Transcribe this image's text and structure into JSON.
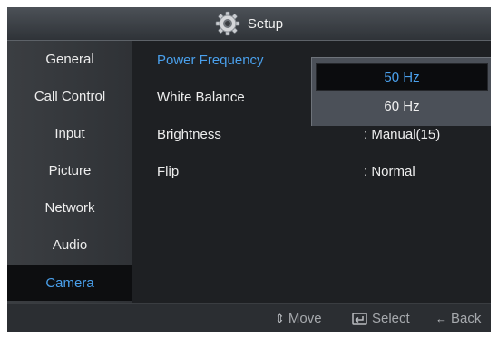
{
  "title": "Setup",
  "title_icon": "gear-icon",
  "sidebar": {
    "items": [
      {
        "label": "General"
      },
      {
        "label": "Call Control"
      },
      {
        "label": "Input"
      },
      {
        "label": "Picture"
      },
      {
        "label": "Network"
      },
      {
        "label": "Audio"
      },
      {
        "label": "Camera",
        "active": true
      }
    ]
  },
  "settings": {
    "rows": [
      {
        "label": "Power Frequency",
        "value": ""
      },
      {
        "label": "White Balance",
        "value": ""
      },
      {
        "label": "Brightness",
        "value": ": Manual(15)"
      },
      {
        "label": "Flip",
        "value": ": Normal"
      }
    ]
  },
  "dropdown": {
    "options": [
      "50 Hz",
      "60 Hz"
    ],
    "selected": "50 Hz"
  },
  "footer": {
    "move": "Move",
    "select": "Select",
    "back": "Back",
    "move_icon": "up-down-arrows-icon",
    "select_icon": "enter-icon",
    "back_icon": "back-arrow-icon"
  },
  "colors": {
    "accent": "#4aa0ec",
    "background": "#1e2023",
    "sidebar": "#3b3e42",
    "dropdown": "#4b5058"
  }
}
